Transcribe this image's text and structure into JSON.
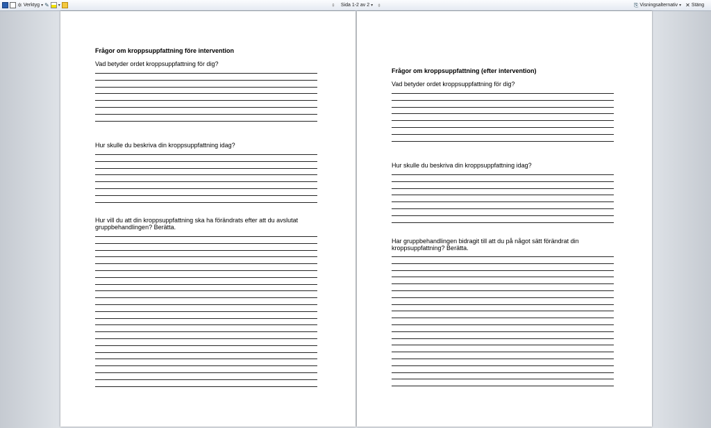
{
  "toolbar": {
    "tools_label": "Verktyg",
    "page_indicator": "Sida 1-2 av 2",
    "view_options_label": "Visningsalternativ",
    "close_label": "Stäng",
    "icons": [
      "save-icon",
      "print-preview-icon",
      "tools-icon",
      "track-changes-icon",
      "highlight-icon",
      "folder-icon",
      "previous-page-icon",
      "next-page-icon",
      "view-options-icon",
      "close-icon"
    ]
  },
  "pages": [
    {
      "title": "Frågor om kroppsuppfattning före intervention",
      "questions": [
        {
          "text": "Vad betyder ordet kroppsuppfattning för dig?",
          "lines": 8
        },
        {
          "text": "Hur skulle du beskriva din kroppsuppfattning idag?",
          "lines": 8
        },
        {
          "text": "Hur vill du att din kroppsuppfattning ska ha förändrats efter att du avslutat gruppbehandlingen? Berätta.",
          "lines": 23
        }
      ]
    },
    {
      "title": "Frågor om kroppsuppfattning (efter intervention)",
      "questions": [
        {
          "text": "Vad betyder ordet kroppsuppfattning för dig?",
          "lines": 8
        },
        {
          "text": "Hur skulle du beskriva din kroppsuppfattning idag?",
          "lines": 8
        },
        {
          "text": "Har gruppbehandlingen bidragit till att du på något sätt förändrat din kroppsuppfattning? Berätta.",
          "lines": 20
        }
      ]
    }
  ]
}
